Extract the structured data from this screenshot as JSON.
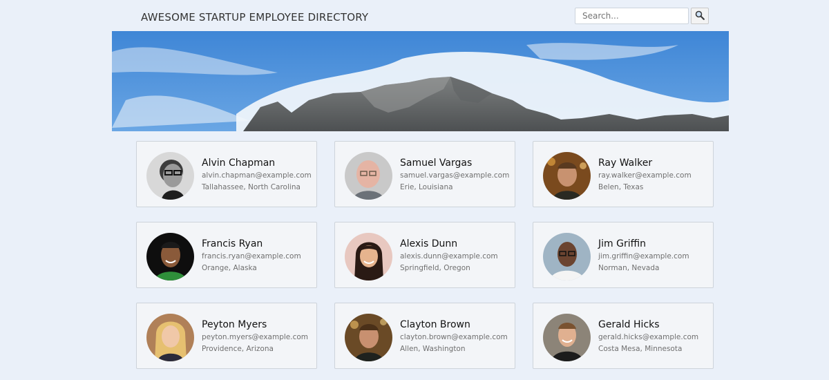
{
  "header": {
    "title": "AWESOME STARTUP EMPLOYEE DIRECTORY"
  },
  "search": {
    "placeholder": "Search...",
    "button_icon": "search-icon"
  },
  "banner": {
    "image": "mountain-banner",
    "colors": {
      "sky": "#4a8fd6",
      "cloud": "#f2f6fb",
      "rock": "#6e7272"
    }
  },
  "employees": [
    {
      "name": "Alvin Chapman",
      "email": "alvin.chapman@example.com",
      "location": "Tallahassee, North Carolina",
      "avatar": "photo-man-glasses-bw"
    },
    {
      "name": "Samuel Vargas",
      "email": "samuel.vargas@example.com",
      "location": "Erie, Louisiana",
      "avatar": "photo-man-bald-glasses"
    },
    {
      "name": "Ray Walker",
      "email": "ray.walker@example.com",
      "location": "Belen, Texas",
      "avatar": "photo-man-smiling"
    },
    {
      "name": "Francis Ryan",
      "email": "francis.ryan@example.com",
      "location": "Orange, Alaska",
      "avatar": "photo-man-green-shirt"
    },
    {
      "name": "Alexis Dunn",
      "email": "alexis.dunn@example.com",
      "location": "Springfield, Oregon",
      "avatar": "photo-woman-dark-hair"
    },
    {
      "name": "Jim Griffin",
      "email": "jim.griffin@example.com",
      "location": "Norman, Nevada",
      "avatar": "photo-man-white-shirt"
    },
    {
      "name": "Peyton Myers",
      "email": "peyton.myers@example.com",
      "location": "Providence, Arizona",
      "avatar": "photo-woman-blonde"
    },
    {
      "name": "Clayton Brown",
      "email": "clayton.brown@example.com",
      "location": "Allen, Washington",
      "avatar": "photo-man-smiling"
    },
    {
      "name": "Gerald Hicks",
      "email": "gerald.hicks@example.com",
      "location": "Costa Mesa, Minnesota",
      "avatar": "photo-man-dark-tshirt"
    }
  ]
}
